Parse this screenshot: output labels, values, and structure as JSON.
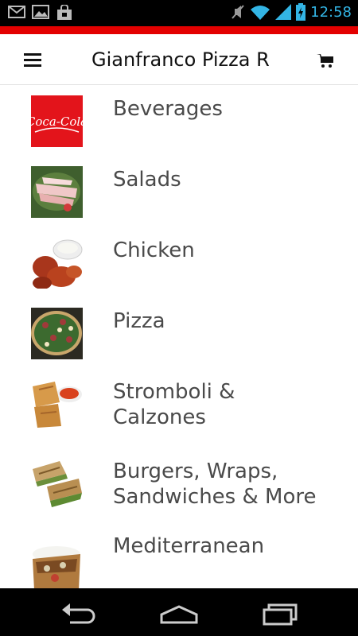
{
  "status_bar": {
    "time": "12:58",
    "icons": [
      "gmail-icon",
      "gallery-icon",
      "shopping-bag-icon",
      "mute-icon",
      "wifi-icon",
      "signal-icon",
      "battery-charging-icon"
    ]
  },
  "app_bar": {
    "title": "Gianfranco Pizza R",
    "menu_icon": "menu-icon",
    "cart_icon": "shopping-cart-icon"
  },
  "categories": [
    {
      "label": "Beverages",
      "thumb": "coca-cola"
    },
    {
      "label": "Salads",
      "thumb": "salad"
    },
    {
      "label": "Chicken",
      "thumb": "chicken-wings"
    },
    {
      "label": "Pizza",
      "thumb": "pizza"
    },
    {
      "label": "Stromboli &\nCalzones",
      "thumb": "stromboli"
    },
    {
      "label": "Burgers, Wraps,\nSandwiches & More",
      "thumb": "sandwich"
    },
    {
      "label": "Mediterranean",
      "thumb": "gyro"
    }
  ],
  "nav_bar": {
    "icons": [
      "back-icon",
      "home-icon",
      "recent-apps-icon"
    ]
  },
  "colors": {
    "accent": "#e30000",
    "status_text": "#33b5e5",
    "label_text": "#4a4a4a"
  }
}
